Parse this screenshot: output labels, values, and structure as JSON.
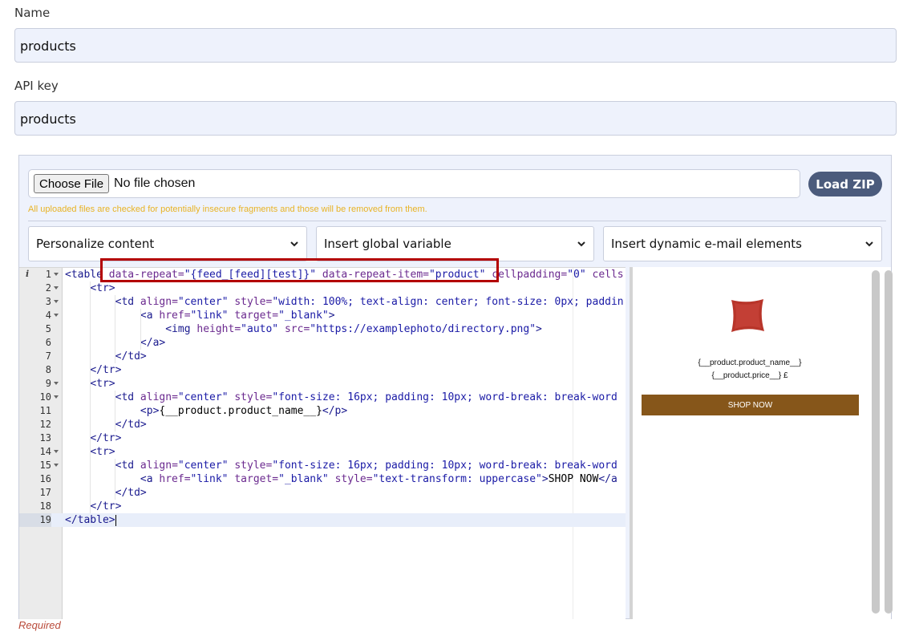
{
  "name_field": {
    "label": "Name",
    "value": "products"
  },
  "api_key_field": {
    "label": "API key",
    "value": "products"
  },
  "upload": {
    "choose_label": "Choose File",
    "status": "No file chosen",
    "load_zip_label": "Load ZIP",
    "notice": "All uploaded files are checked for potentially insecure fragments and those will be removed from them."
  },
  "selects": {
    "personalize": "Personalize content",
    "global_variable": "Insert global variable",
    "dynamic_elements": "Insert dynamic e-mail elements"
  },
  "editor": {
    "lines": [
      {
        "n": "1",
        "fold": true
      },
      {
        "n": "2",
        "fold": true
      },
      {
        "n": "3",
        "fold": true
      },
      {
        "n": "4",
        "fold": true
      },
      {
        "n": "5",
        "fold": false
      },
      {
        "n": "6",
        "fold": false
      },
      {
        "n": "7",
        "fold": false
      },
      {
        "n": "8",
        "fold": false
      },
      {
        "n": "9",
        "fold": true
      },
      {
        "n": "10",
        "fold": true
      },
      {
        "n": "11",
        "fold": false
      },
      {
        "n": "12",
        "fold": false
      },
      {
        "n": "13",
        "fold": false
      },
      {
        "n": "14",
        "fold": true
      },
      {
        "n": "15",
        "fold": true
      },
      {
        "n": "16",
        "fold": false
      },
      {
        "n": "17",
        "fold": false
      },
      {
        "n": "18",
        "fold": false
      },
      {
        "n": "19",
        "fold": false
      }
    ],
    "code": {
      "l1_tag": "<table",
      "l1_attrs": " data-repeat=",
      "l1_v1": "\"{feed_[feed][test]}\"",
      "l1_a2": " data-repeat-item=",
      "l1_v2": "\"product\"",
      "l1_a3": " cellpadding=",
      "l1_v3": "\"0\"",
      "l1_a4": " cells",
      "l2": "<tr>",
      "l3_tag": "<td",
      "l3_a1": " align=",
      "l3_v1": "\"center\"",
      "l3_a2": " style=",
      "l3_v2": "\"width: 100%; text-align: center; font-size: 0px; paddin",
      "l4_tag": "<a",
      "l4_a1": " href=",
      "l4_v1": "\"link\"",
      "l4_a2": " target=",
      "l4_v2": "\"_blank\"",
      "l4_end": ">",
      "l5_tag": "<img",
      "l5_a1": " height=",
      "l5_v1": "\"auto\"",
      "l5_a2": " src=",
      "l5_v2": "\"https://examplephoto/directory.png\"",
      "l5_end": ">",
      "l6": "</a>",
      "l7": "</td>",
      "l8": "</tr>",
      "l9": "<tr>",
      "l10_tag": "<td",
      "l10_a1": " align=",
      "l10_v1": "\"center\"",
      "l10_a2": " style=",
      "l10_v2": "\"font-size: 16px; padding: 10px; word-break: break-word",
      "l11_open": "<p>",
      "l11_text": "{__product.product_name__}",
      "l11_close": "</p>",
      "l12": "</td>",
      "l13": "</tr>",
      "l14": "<tr>",
      "l15_tag": "<td",
      "l15_a1": " align=",
      "l15_v1": "\"center\"",
      "l15_a2": " style=",
      "l15_v2": "\"font-size: 16px; padding: 10px; word-break: break-word",
      "l16_tag": "<a",
      "l16_a1": " href=",
      "l16_v1": "\"link\"",
      "l16_a2": " target=",
      "l16_v2": "\"_blank\"",
      "l16_a3": " style=",
      "l16_v3": "\"text-transform: uppercase\"",
      "l16_gt": ">",
      "l16_text": "SHOP NOW",
      "l16_close": "</a",
      "l17": "</td>",
      "l18": "</tr>",
      "l19": "</table>"
    }
  },
  "preview": {
    "product_name": "{__product.product_name__}",
    "product_price": "{__product.price__} £",
    "shop_now": "SHOP NOW"
  },
  "required_text": "Required",
  "colors": {
    "load_zip_bg": "#4b5b7c",
    "notice": "#e8b325",
    "highlight_border": "#b30000",
    "shop_button_bg": "#86561a",
    "pillow": "#b8352a"
  }
}
